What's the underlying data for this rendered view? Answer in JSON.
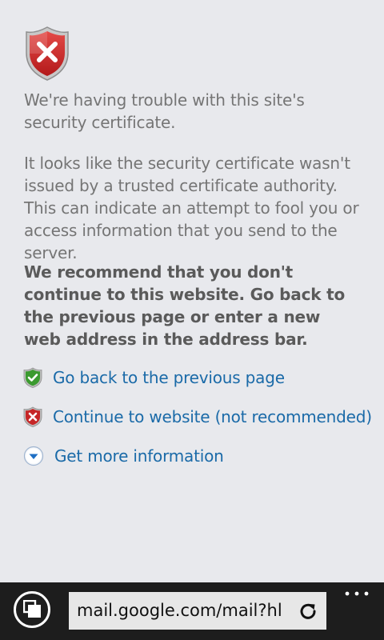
{
  "page": {
    "heading": "We're having trouble with this site's security certificate.",
    "explanation": "It looks like the security certificate wasn't issued by a trusted certificate authority. This can indicate an attempt to fool you or access information that you send to the server.",
    "recommendation": "We recommend that you don't continue to this website. Go back to the previous page or enter a new web address in the address bar.",
    "links": [
      {
        "label": "Go back to the previous page",
        "icon": "green-shield-check-icon"
      },
      {
        "label": "Continue to website (not recommended)",
        "icon": "red-shield-x-icon"
      },
      {
        "label": "Get more information",
        "icon": "blue-chevron-down-icon"
      }
    ]
  },
  "appbar": {
    "url": "mail.google.com/mail?hl",
    "icons": [
      "tabs-icon",
      "refresh-icon",
      "more-icon"
    ]
  },
  "colors": {
    "background": "#e8e9ed",
    "link": "#1a6aa8",
    "body_text": "#757575",
    "appbar": "#1d1d1d"
  }
}
